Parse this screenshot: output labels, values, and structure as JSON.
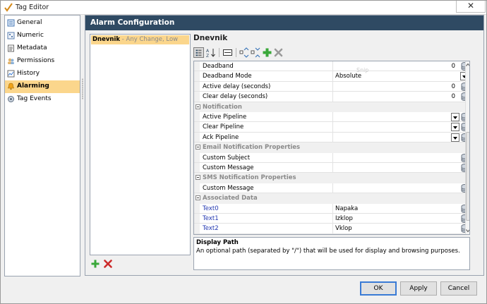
{
  "window": {
    "title": "Tag Editor",
    "close_glyph": "✕"
  },
  "nav": {
    "items": [
      {
        "label": "General",
        "icon": "general-icon"
      },
      {
        "label": "Numeric",
        "icon": "numeric-icon"
      },
      {
        "label": "Metadata",
        "icon": "metadata-icon"
      },
      {
        "label": "Permissions",
        "icon": "permissions-icon"
      },
      {
        "label": "History",
        "icon": "history-icon"
      },
      {
        "label": "Alarming",
        "icon": "alarming-icon",
        "selected": true
      },
      {
        "label": "Tag Events",
        "icon": "tag-events-icon"
      }
    ]
  },
  "panel": {
    "title": "Alarm Configuration"
  },
  "alarm_list": {
    "items": [
      {
        "name": "Dnevnik",
        "separator": " - ",
        "mode": "Any Change, Low"
      }
    ]
  },
  "selected_alarm": {
    "name": "Dnevnik"
  },
  "property_grid": {
    "ghost_text": "Snip",
    "rows": [
      {
        "type": "prop",
        "label": "Deadband",
        "value": "0",
        "editor": "number"
      },
      {
        "type": "prop",
        "label": "Deadband Mode",
        "value": "Absolute",
        "editor": "dropdown"
      },
      {
        "type": "prop",
        "label": "Active delay (seconds)",
        "value": "0",
        "editor": "number"
      },
      {
        "type": "prop",
        "label": "Clear delay (seconds)",
        "value": "0",
        "editor": "number"
      },
      {
        "type": "category",
        "label": "Notification"
      },
      {
        "type": "prop",
        "label": "Active Pipeline",
        "value": "",
        "editor": "dropdown-bind"
      },
      {
        "type": "prop",
        "label": "Clear Pipeline",
        "value": "",
        "editor": "dropdown-bind"
      },
      {
        "type": "prop",
        "label": "Ack Pipeline",
        "value": "",
        "editor": "dropdown-bind"
      },
      {
        "type": "category",
        "label": "Email Notification Properties"
      },
      {
        "type": "prop",
        "label": "Custom Subject",
        "value": "",
        "editor": "bind"
      },
      {
        "type": "prop",
        "label": "Custom Message",
        "value": "",
        "editor": "bind"
      },
      {
        "type": "category",
        "label": "SMS Notification Properties"
      },
      {
        "type": "prop",
        "label": "Custom Message",
        "value": "",
        "editor": "bind"
      },
      {
        "type": "category",
        "label": "Associated Data"
      },
      {
        "type": "prop",
        "label": "Text0",
        "value": "Napaka",
        "editor": "bind",
        "link": true
      },
      {
        "type": "prop",
        "label": "Text1",
        "value": "Izklop",
        "editor": "bind",
        "link": true
      },
      {
        "type": "prop",
        "label": "Text2",
        "value": "Vklop",
        "editor": "bind",
        "link": true
      }
    ]
  },
  "description": {
    "title": "Display Path",
    "text": "An optional path (separated by \"/\") that will be used for display and browsing purposes."
  },
  "buttons": {
    "ok": "OK",
    "apply": "Apply",
    "cancel": "Cancel"
  },
  "colors": {
    "header": "#2f4a63",
    "selection": "#fbd68c",
    "add": "#3aa83a",
    "delete": "#cc2b2b",
    "link": "#2036b0"
  }
}
